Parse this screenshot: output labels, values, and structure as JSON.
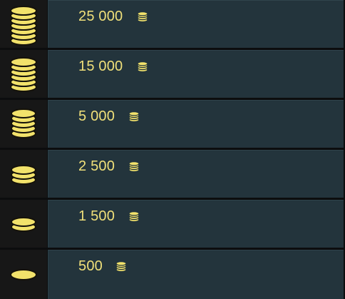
{
  "colors": {
    "background": "#0c0d0e",
    "icon_cell": "#171717",
    "panel": "#23343c",
    "amount_text": "#f0e07a",
    "coin_gold": "#f2e26b",
    "coin_shadow": "#15120a"
  },
  "packs": [
    {
      "amount": "25 000",
      "stack_icon": "coin-stack-large-icon",
      "currency_icon": "coin-icon"
    },
    {
      "amount": "15 000",
      "stack_icon": "coin-stack-medium-icon",
      "currency_icon": "coin-icon"
    },
    {
      "amount": "5 000",
      "stack_icon": "coin-stack-small-icon",
      "currency_icon": "coin-icon"
    },
    {
      "amount": "2 500",
      "stack_icon": "coin-stack-mini-icon",
      "currency_icon": "coin-icon"
    },
    {
      "amount": "1 500",
      "stack_icon": "coin-pair-icon",
      "currency_icon": "coin-icon"
    },
    {
      "amount": "500",
      "stack_icon": "single-coin-icon",
      "currency_icon": "coin-icon"
    }
  ]
}
